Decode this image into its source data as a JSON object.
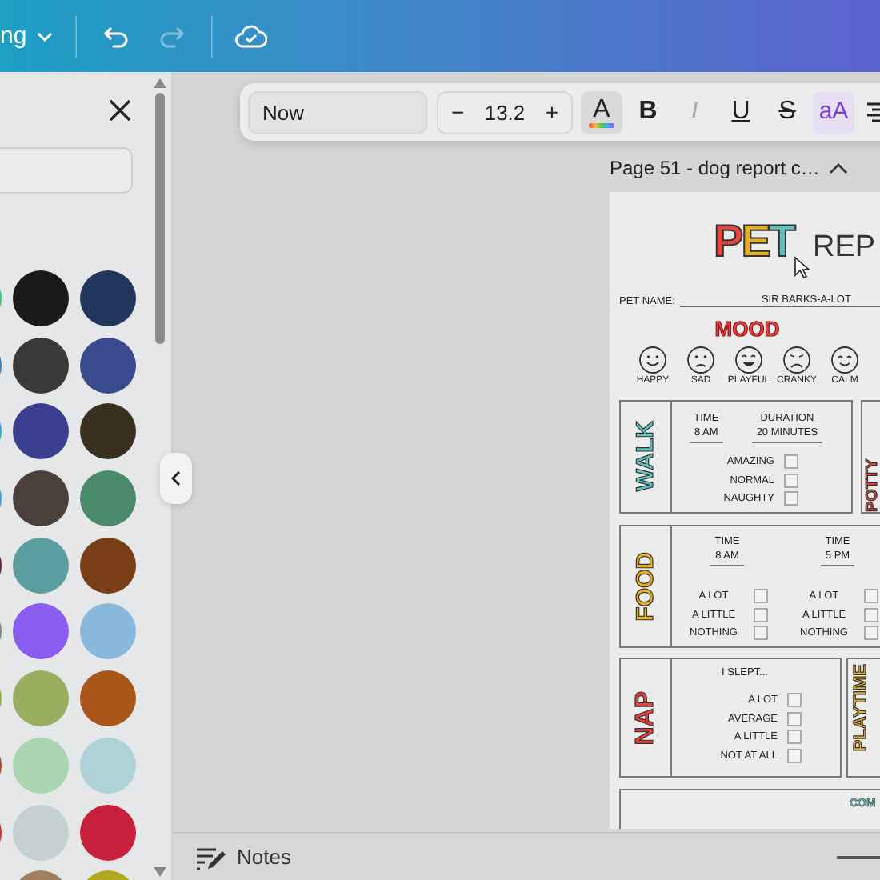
{
  "top_bar": {
    "menu_label": "ng",
    "undo": {
      "disabled": false
    },
    "redo": {
      "disabled": true
    }
  },
  "side_panel": {
    "swatches": [
      {
        "color": "#2ecc71"
      },
      {
        "color": "#1a1a1a"
      },
      {
        "color": "#22365e"
      },
      {
        "color": "#3a7fc0"
      },
      {
        "color": "#393939"
      },
      {
        "color": "#3a4a8f"
      },
      {
        "color": "#30b0d0"
      },
      {
        "color": "#3b3f8f"
      },
      {
        "color": "#3a3020"
      },
      {
        "color": "#40a0e0"
      },
      {
        "color": "#4a403c"
      },
      {
        "color": "#4a8a6a"
      },
      {
        "color": "#702040"
      },
      {
        "color": "#5b9ea0"
      },
      {
        "color": "#7a3e16"
      },
      {
        "color": "#7a8a8a"
      },
      {
        "color": "#8b5cf0"
      },
      {
        "color": "#88b8dc"
      },
      {
        "color": "#90b040"
      },
      {
        "color": "#9aae60"
      },
      {
        "color": "#a8561a"
      },
      {
        "color": "#a05020"
      },
      {
        "color": "#a9d5b0"
      },
      {
        "color": "#aed2d8"
      },
      {
        "color": "#d03030"
      },
      {
        "color": "#c5d0d0"
      },
      {
        "color": "#c8203c"
      },
      {
        "color": "#a08060"
      },
      {
        "color": "#b0a820"
      }
    ]
  },
  "toolbar": {
    "font": "Now",
    "decrease": "−",
    "size": "13.2",
    "increase": "+",
    "buttons": [
      {
        "kind": "text-color",
        "label": "A",
        "selected": true,
        "disabled": false
      },
      {
        "kind": "bold",
        "label": "B",
        "selected": false,
        "disabled": false
      },
      {
        "kind": "italic",
        "label": "I",
        "selected": false,
        "disabled": true
      },
      {
        "kind": "underline",
        "label": "U",
        "selected": false,
        "disabled": false
      },
      {
        "kind": "strikethrough",
        "label": "S",
        "selected": false,
        "disabled": false
      },
      {
        "kind": "case",
        "label": "aA",
        "selected": true,
        "disabled": false
      },
      {
        "kind": "align",
        "selected": false,
        "disabled": false
      }
    ]
  },
  "page": {
    "title": "Page 51 - dog report c…"
  },
  "report": {
    "title": "PET",
    "title_rest": "REP",
    "pet_name_label": "PET NAME:",
    "pet_name": "SIR BARKS-A-LOT",
    "mood_heading": "MOOD",
    "moods": [
      {
        "kind": "happy",
        "label": "HAPPY"
      },
      {
        "kind": "sad",
        "label": "SAD"
      },
      {
        "kind": "playful",
        "label": "PLAYFUL"
      },
      {
        "kind": "cranky",
        "label": "CRANKY"
      },
      {
        "kind": "calm",
        "label": "CALM"
      }
    ],
    "walk": {
      "heading": "WALK",
      "fields": [
        {
          "label": "TIME",
          "value": "8 AM"
        },
        {
          "label": "DURATION",
          "value": "20 MINUTES"
        }
      ],
      "options": [
        {
          "label": "AMAZING",
          "checked": false
        },
        {
          "label": "NORMAL",
          "checked": false
        },
        {
          "label": "NAUGHTY",
          "checked": false
        }
      ]
    },
    "potty": {
      "heading": "POTTY"
    },
    "food": {
      "heading": "FOOD",
      "meals": [
        {
          "label": "TIME",
          "value": "8 AM",
          "options": [
            {
              "label": "A LOT",
              "checked": false
            },
            {
              "label": "A LITTLE",
              "checked": false
            },
            {
              "label": "NOTHING",
              "checked": false
            }
          ]
        },
        {
          "label": "TIME",
          "value": "5 PM",
          "options": [
            {
              "label": "A LOT",
              "checked": false
            },
            {
              "label": "A LITTLE",
              "checked": false
            },
            {
              "label": "NOTHING",
              "checked": false
            }
          ]
        }
      ]
    },
    "nap": {
      "heading": "NAP",
      "prompt": "I SLEPT...",
      "options": [
        {
          "label": "A LOT",
          "checked": false
        },
        {
          "label": "AVERAGE",
          "checked": false
        },
        {
          "label": "A LITTLE",
          "checked": false
        },
        {
          "label": "NOT AT ALL",
          "checked": false
        }
      ]
    },
    "playtime": {
      "heading": "PLAYTIME"
    },
    "comments": {
      "heading": "COM"
    }
  },
  "notes_bar": {
    "label": "Notes"
  }
}
